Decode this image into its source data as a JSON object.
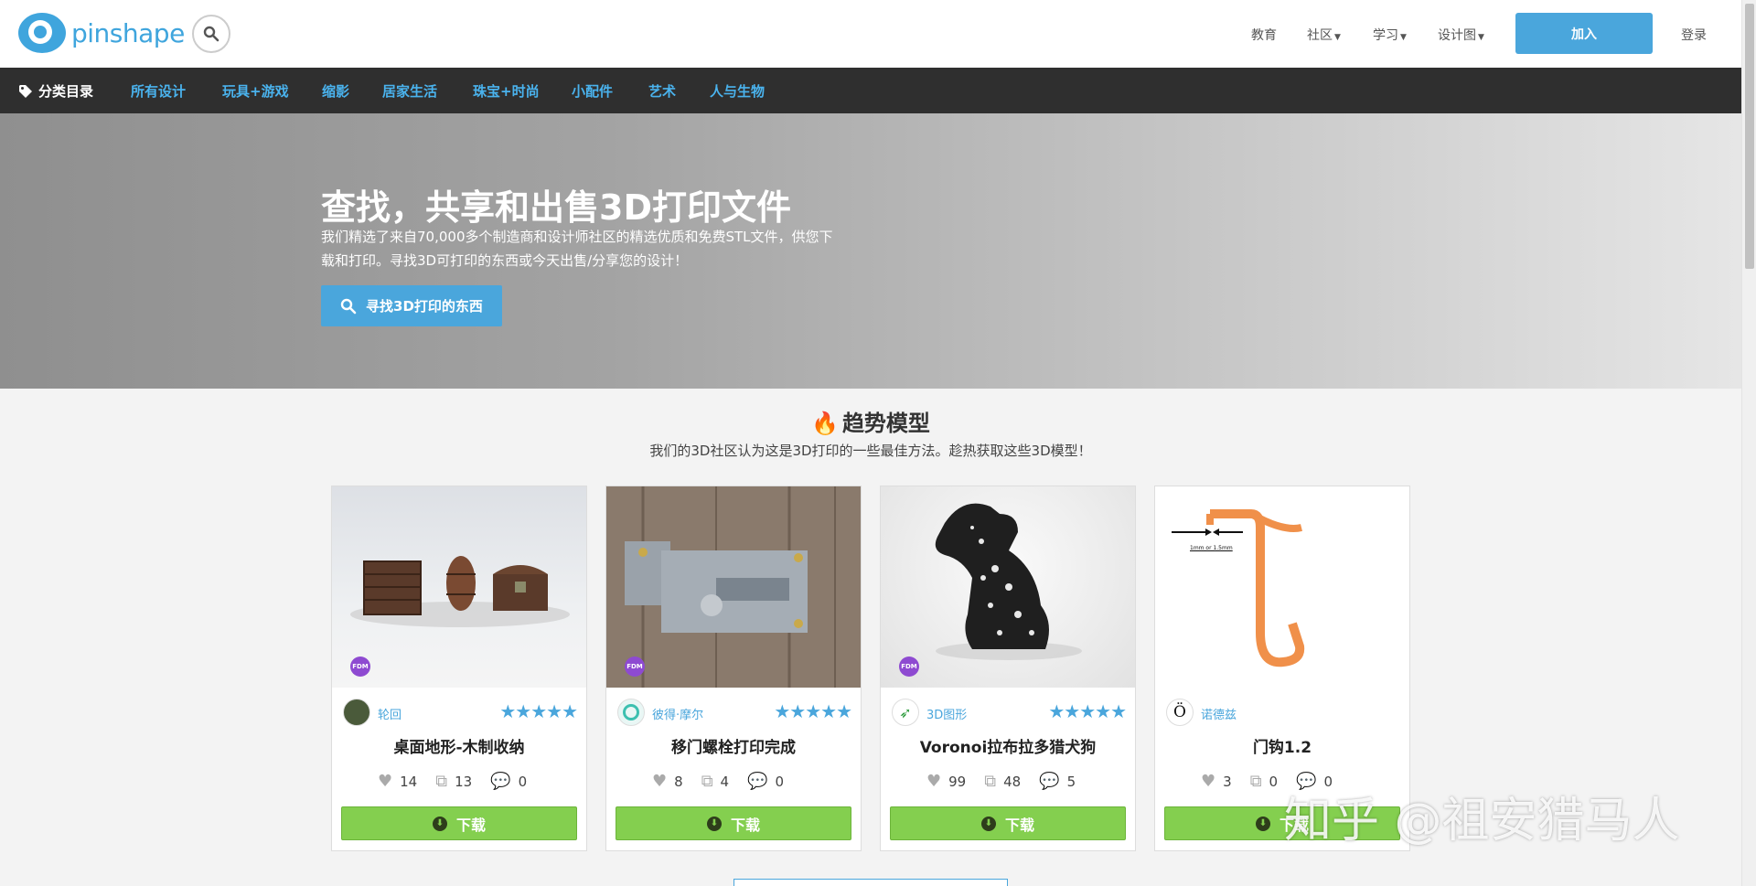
{
  "header": {
    "logo_text": "pinshape",
    "nav": [
      {
        "label": "教育",
        "caret": false
      },
      {
        "label": "社区",
        "caret": true
      },
      {
        "label": "学习",
        "caret": true
      },
      {
        "label": "设计图",
        "caret": true
      }
    ],
    "join_label": "加入",
    "login_label": "登录"
  },
  "categories": {
    "heading": "分类目录",
    "items": [
      "所有设计",
      "玩具+游戏",
      "缩影",
      "居家生活",
      "珠宝+时尚",
      "小配件",
      "艺术",
      "人与生物"
    ]
  },
  "hero": {
    "title": "查找，共享和出售3D打印文件",
    "subtitle_line1": "我们精选了来自70,000多个制造商和设计师社区的精选优质和免费STL文件，供您下",
    "subtitle_line2": "载和打印。寻找3D可打印的东西或今天出售/分享您的设计！",
    "button_label": "寻找3D打印的东西"
  },
  "trending": {
    "title": "趋势模型",
    "subtitle": "我们的3D社区认为这是3D打印的一些最佳方法。趁热获取这些3D模型！",
    "cards": [
      {
        "author": "轮回",
        "title": "桌面地形-木制收纳",
        "likes": "14",
        "makes": "13",
        "comments": "0",
        "badge": "FDM",
        "rating_stars": 5,
        "download_label": "下载"
      },
      {
        "author": "彼得·摩尔",
        "title": "移门螺栓打印完成",
        "likes": "8",
        "makes": "4",
        "comments": "0",
        "badge": "FDM",
        "rating_stars": 5,
        "download_label": "下载"
      },
      {
        "author": "3D图形",
        "title": "Voronoi拉布拉多猎犬狗",
        "likes": "99",
        "makes": "48",
        "comments": "5",
        "badge": "FDM",
        "rating_stars": 5,
        "download_label": "下载"
      },
      {
        "author": "诺德兹",
        "title": "门钩1.2",
        "likes": "3",
        "makes": "0",
        "comments": "0",
        "badge": "",
        "rating_stars": 5,
        "download_label": "下载"
      }
    ]
  },
  "hook_label": "1mm or 1.5mm",
  "watermark": "知乎 @祖安猎马人",
  "colors": {
    "accent": "#4aa6dc",
    "dark_bar": "#2f2f2f",
    "download_green": "#84cf4f",
    "flame": "#f08a22",
    "hook_orange": "#f0904a"
  }
}
